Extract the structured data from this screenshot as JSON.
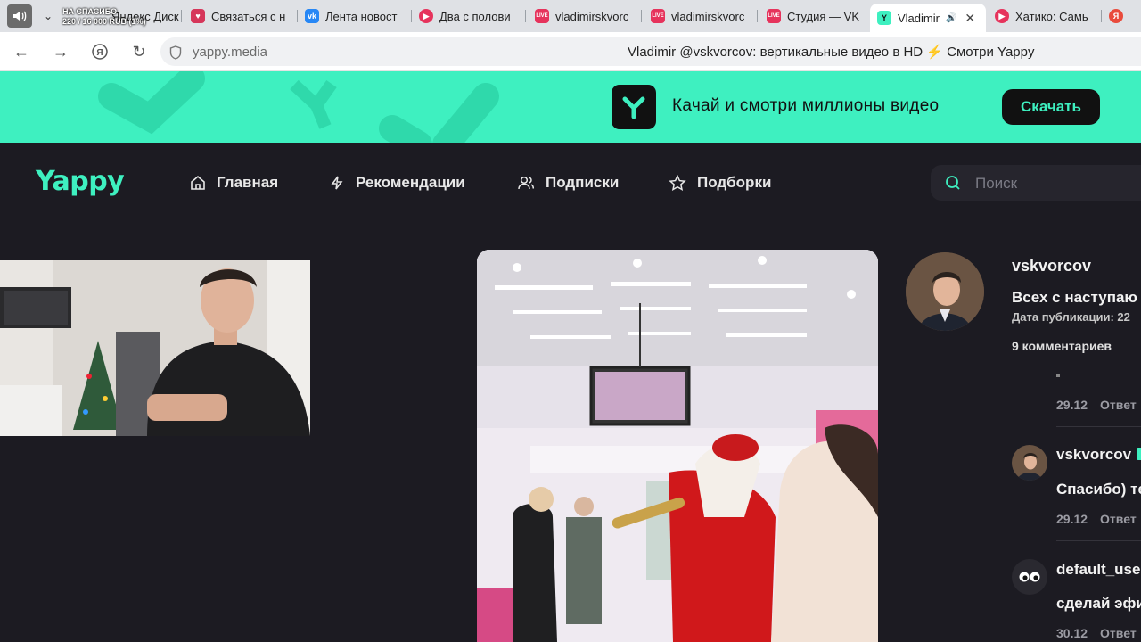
{
  "browser": {
    "donation": {
      "line1": "НА СПАСИБО",
      "line2": "220 / 16 000 RUB (1%)"
    },
    "tabs": [
      {
        "label": "Яндекс Диск",
        "icon": "yandex-disk-icon",
        "color": "#e94b3c"
      },
      {
        "label": "Связаться с н",
        "icon": "heart-icon",
        "color": "#d6365a"
      },
      {
        "label": "Лента новост",
        "icon": "vk-icon",
        "color": "#2787f5"
      },
      {
        "label": "Два с полови",
        "icon": "play-icon",
        "color": "#e6335c"
      },
      {
        "label": "vladimirskvorc",
        "icon": "live-icon",
        "color": "#e6335c"
      },
      {
        "label": "vladimirskvorc",
        "icon": "live-icon",
        "color": "#e6335c"
      },
      {
        "label": "Студия — VK",
        "icon": "live-icon",
        "color": "#e6335c"
      },
      {
        "label": "Vladimir",
        "icon": "yappy-icon",
        "color": "#3ef0c0",
        "active": true
      },
      {
        "label": "Хатико: Самь",
        "icon": "play-icon",
        "color": "#e6335c"
      },
      {
        "label": "",
        "icon": "yandex-icon",
        "color": "#e94b3c"
      }
    ],
    "url": "yappy.media",
    "page_title": "Vladimir @vskvorcov: вертикальные видео в HD ⚡ Смотри Yappy"
  },
  "promo": {
    "text": "Качай и смотри миллионы видео",
    "button": "Скачать"
  },
  "header": {
    "brand": "Yappy",
    "nav": [
      {
        "label": "Главная",
        "icon": "home-icon"
      },
      {
        "label": "Рекомендации",
        "icon": "lightning-icon"
      },
      {
        "label": "Подписки",
        "icon": "people-icon"
      },
      {
        "label": "Подборки",
        "icon": "star-icon"
      }
    ],
    "search_placeholder": "Поиск"
  },
  "post": {
    "author": "vskvorcov",
    "description": "Всех с наступаю",
    "date_label": "Дата публикации: 22",
    "comments_count": "9 комментариев"
  },
  "comments": [
    {
      "user": "",
      "text": "",
      "date": "29.12",
      "reply": "Ответ"
    },
    {
      "user": "vskvorcov",
      "text": "Спасибо) те",
      "date": "29.12",
      "reply": "Ответ"
    },
    {
      "user": "default_user",
      "text": "сделай эфи",
      "date": "30.12",
      "reply": "Ответ"
    }
  ]
}
